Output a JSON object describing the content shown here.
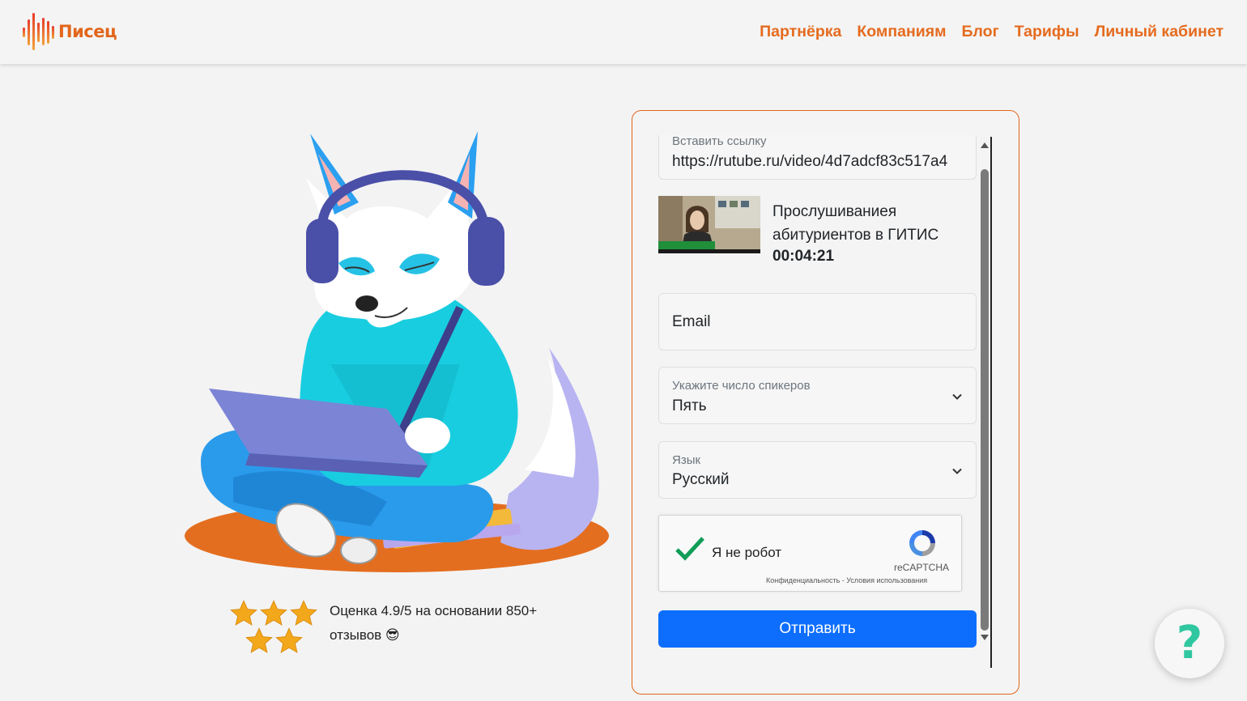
{
  "header": {
    "logo_text": "Писец",
    "nav": [
      "Партнёрка",
      "Компаниям",
      "Блог",
      "Тарифы",
      "Личный кабинет"
    ]
  },
  "rating": {
    "text": "Оценка 4.9/5 на основании 850+ отзывов 😎",
    "stars": 5
  },
  "form": {
    "link_label": "Вставить ссылку",
    "link_value": "https://rutube.ru/video/4d7adcf83c517a4",
    "video_title": "Прослушиваниея абитуриентов в ГИТИС",
    "video_duration": "00:04:21",
    "email_placeholder": "Email",
    "speakers_label": "Укажите число спикеров",
    "speakers_value": "Пять",
    "language_label": "Язык",
    "language_value": "Русский",
    "captcha_label": "Я не робот",
    "captcha_brand": "reCAPTCHA",
    "captcha_links": "Конфиденциальность - Условия использования",
    "submit_label": "Отправить"
  },
  "help": {
    "label": "?"
  },
  "colors": {
    "accent": "#e2661b",
    "primary": "#0d6efd",
    "help": "#2fc7a0"
  },
  "icons": [
    "logo-soundwave-icon",
    "chevron-down-icon",
    "checkmark-icon",
    "recaptcha-icon",
    "star-icon",
    "help-icon"
  ]
}
